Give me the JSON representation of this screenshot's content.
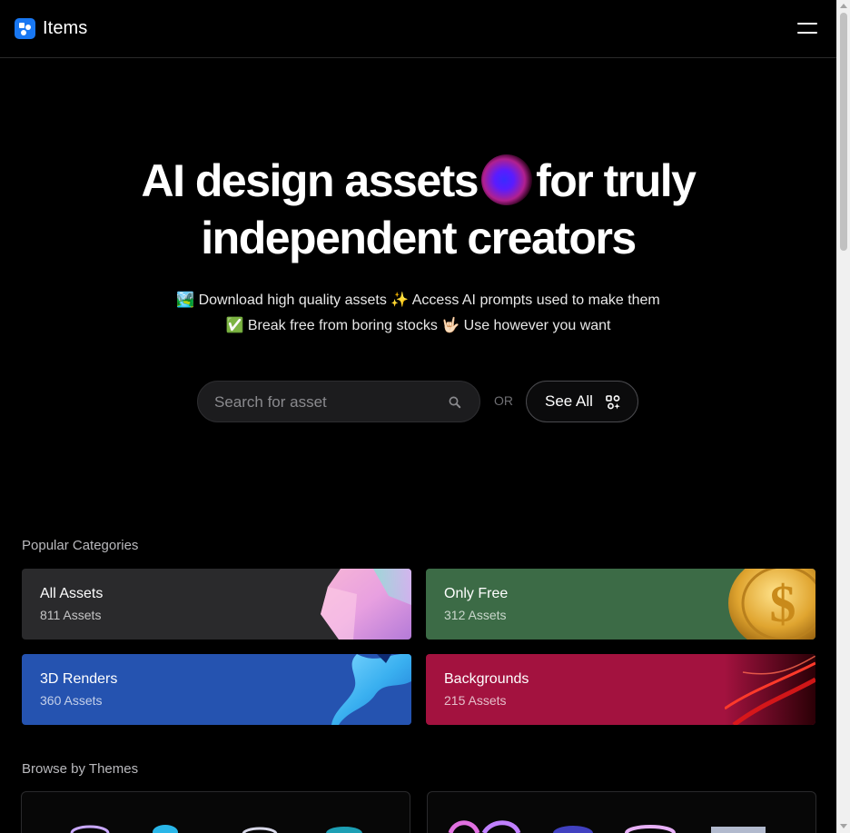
{
  "header": {
    "brand": "Items",
    "menu_icon": "hamburger-menu-icon"
  },
  "hero": {
    "title_part1": "AI design assets",
    "title_part2": "for truly",
    "title_line2": "independent creators",
    "sub_line1": "🏞️ Download high quality assets ✨ Access AI prompts used to make them",
    "sub_line2": "✅ Break free from boring stocks 🤟🏻 Use however you want"
  },
  "search": {
    "placeholder": "Search for asset",
    "value": "",
    "icon": "search-icon"
  },
  "or_label": "OR",
  "see_all": {
    "label": "See All",
    "icon": "sparkle-logo-icon"
  },
  "categories_section": {
    "title": "Popular Categories",
    "items": [
      {
        "name": "All Assets",
        "count": "811 Assets",
        "color": "#2a2a2c"
      },
      {
        "name": "Only Free",
        "count": "312 Assets",
        "color": "#3c6b46"
      },
      {
        "name": "3D Renders",
        "count": "360 Assets",
        "color": "#2553b0"
      },
      {
        "name": "Backgrounds",
        "count": "215 Assets",
        "color": "#a3123f"
      }
    ]
  },
  "themes_section": {
    "title": "Browse by Themes"
  },
  "colors": {
    "brand_blue": "#1877f2",
    "background": "#000000"
  }
}
